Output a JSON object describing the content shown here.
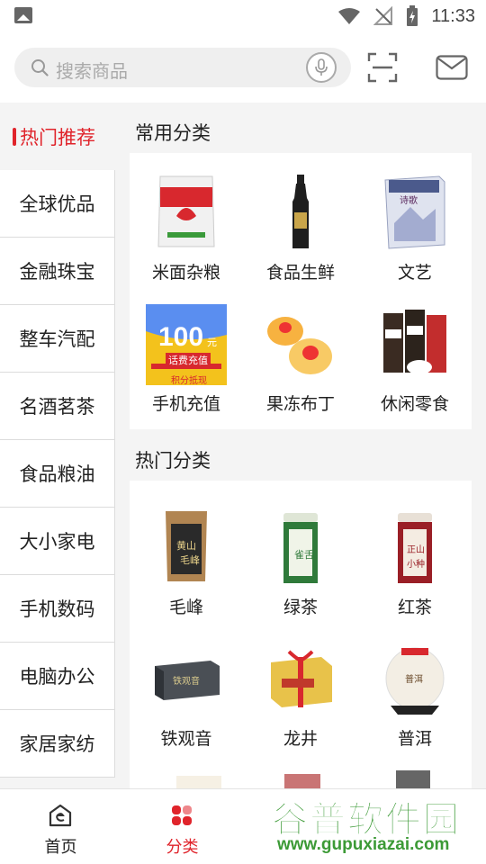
{
  "status_bar": {
    "time": "11:33"
  },
  "search": {
    "placeholder": "搜索商品"
  },
  "sidebar": {
    "items": [
      {
        "label": "热门推荐",
        "active": true
      },
      {
        "label": "全球优品"
      },
      {
        "label": "金融珠宝"
      },
      {
        "label": "整车汽配"
      },
      {
        "label": "名酒茗茶"
      },
      {
        "label": "食品粮油"
      },
      {
        "label": "大小家电"
      },
      {
        "label": "手机数码"
      },
      {
        "label": "电脑办公"
      },
      {
        "label": "家居家纺"
      }
    ]
  },
  "common_section": {
    "title": "常用分类",
    "items": [
      {
        "label": "米面杂粮",
        "icon": "rice-bag-icon"
      },
      {
        "label": "食品生鲜",
        "icon": "oil-bottle-icon"
      },
      {
        "label": "文艺",
        "icon": "book-box-icon"
      },
      {
        "label": "手机充值",
        "icon": "recharge-card-icon",
        "card_text": "100",
        "card_unit": "元",
        "card_sub": "话费充值",
        "card_badge": "积分抵现"
      },
      {
        "label": "果冻布丁",
        "icon": "jelly-icon"
      },
      {
        "label": "休闲零食",
        "icon": "snack-icon"
      }
    ]
  },
  "hot_section": {
    "title": "热门分类",
    "items": [
      {
        "label": "毛峰",
        "icon": "tea-bag-icon"
      },
      {
        "label": "绿茶",
        "icon": "green-tea-can-icon"
      },
      {
        "label": "红茶",
        "icon": "red-tea-can-icon"
      },
      {
        "label": "铁观音",
        "icon": "tea-box-icon"
      },
      {
        "label": "龙井",
        "icon": "gift-box-icon"
      },
      {
        "label": "普洱",
        "icon": "puer-cake-icon"
      }
    ]
  },
  "bottom_nav": {
    "items": [
      {
        "label": "首页",
        "icon": "home-icon"
      },
      {
        "label": "分类",
        "icon": "category-icon",
        "active": true
      }
    ]
  },
  "watermark": {
    "text": "谷普软件园",
    "url": "www.gupuxiazai.com"
  },
  "colors": {
    "accent": "#e0242b",
    "background": "#f4f4f4"
  }
}
